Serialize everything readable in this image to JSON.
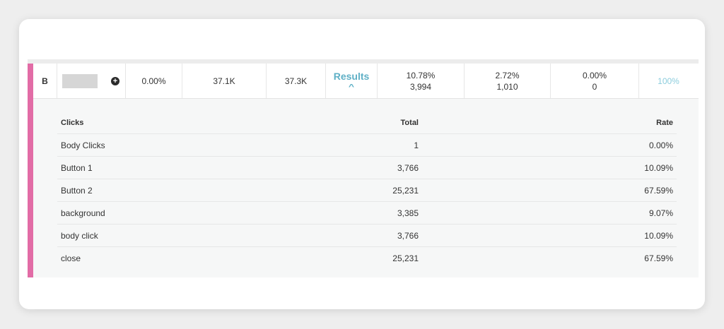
{
  "variant_row": {
    "variant": "B",
    "rate": "0.00%",
    "stat1": "37.1K",
    "stat2": "37.3K",
    "results_link": "Results",
    "metric1": {
      "pct": "10.78%",
      "count": "3,994"
    },
    "metric2": {
      "pct": "2.72%",
      "count": "1,010"
    },
    "metric3": {
      "pct": "0.00%",
      "count": "0"
    },
    "allocation": "100%"
  },
  "clicks_table": {
    "headers": {
      "label": "Clicks",
      "total": "Total",
      "rate": "Rate"
    },
    "rows": [
      {
        "label": "Body Clicks",
        "total": "1",
        "rate": "0.00%"
      },
      {
        "label": "Button 1",
        "total": "3,766",
        "rate": "10.09%"
      },
      {
        "label": "Button 2",
        "total": "25,231",
        "rate": "67.59%"
      },
      {
        "label": "background",
        "total": "3,385",
        "rate": "9.07%"
      },
      {
        "label": "body click",
        "total": "3,766",
        "rate": "10.09%"
      },
      {
        "label": "close",
        "total": "25,231",
        "rate": "67.59%"
      }
    ]
  },
  "colors": {
    "accent": "#e26ca6",
    "results_link": "#5fb0c6",
    "allocation_text": "#8ccddd",
    "panel_bg": "#f6f7f7"
  }
}
